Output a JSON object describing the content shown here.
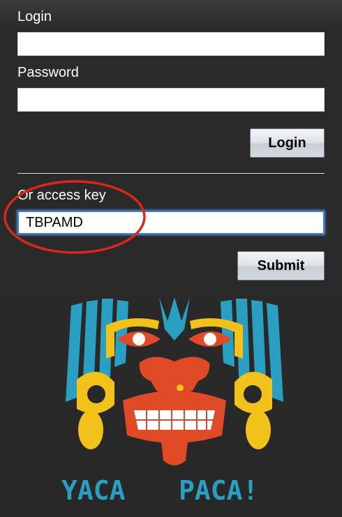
{
  "login_form": {
    "login_label": "Login",
    "login_value": "",
    "password_label": "Password",
    "password_value": "",
    "login_button": "Login"
  },
  "access_key_form": {
    "label": "Or access key",
    "value": "TBPAMD",
    "submit_button": "Submit"
  },
  "logo": {
    "text_left": "YACA",
    "text_right": "PACA!",
    "colors": {
      "blue": "#2a9fc1",
      "yellow": "#f3c21a",
      "red": "#e04a26",
      "white": "#ffffff"
    }
  },
  "annotation": {
    "color": "#d8281c",
    "shape": "ellipse"
  }
}
